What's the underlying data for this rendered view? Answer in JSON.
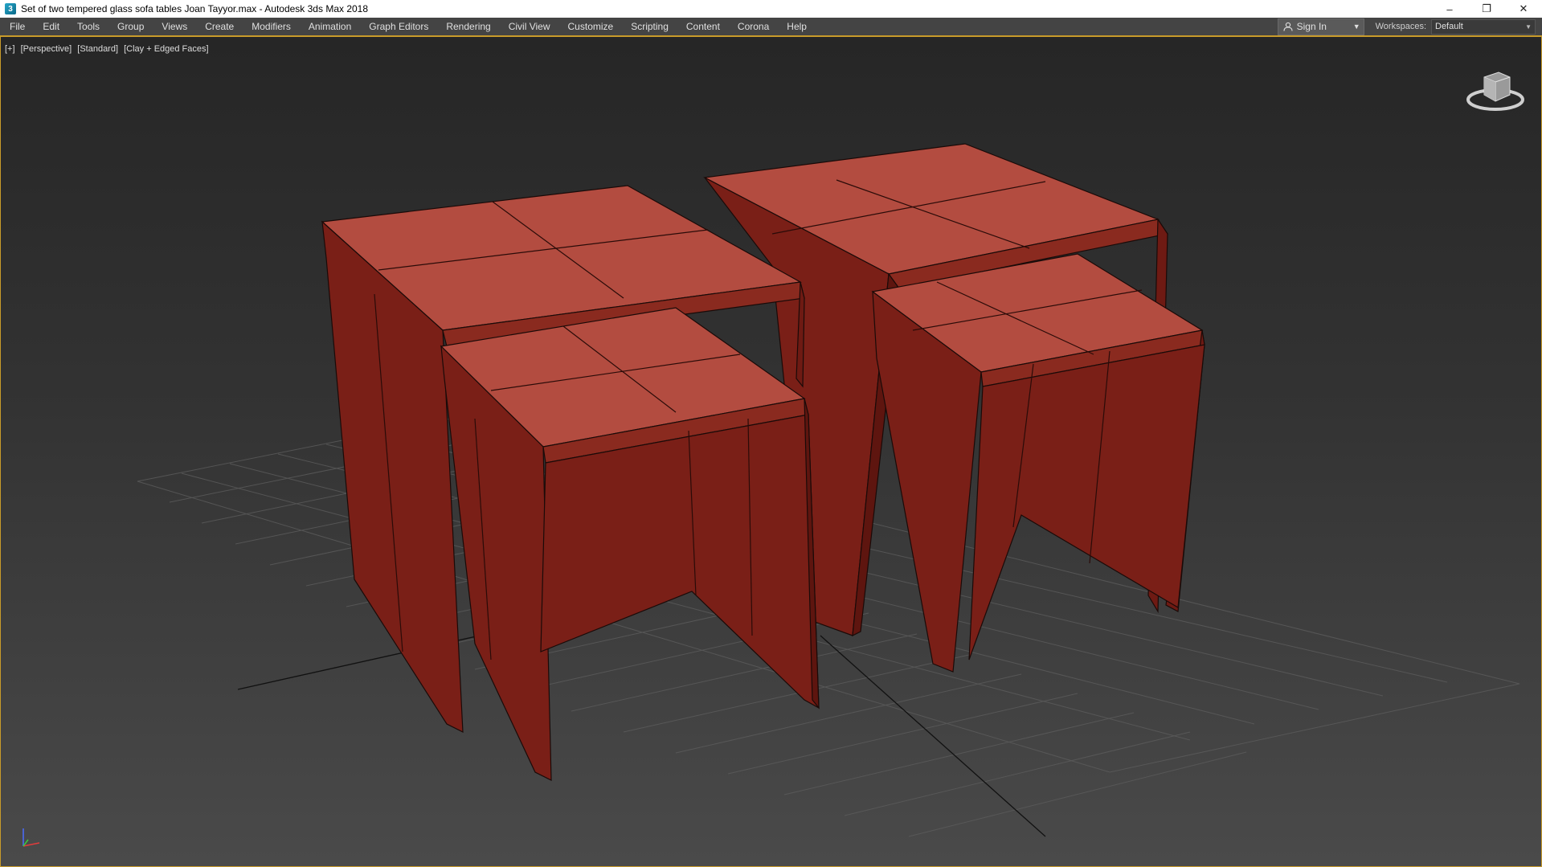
{
  "window": {
    "app_icon": "3ds-max-icon",
    "title": "Set of two tempered glass sofa tables Joan Tayyor.max - Autodesk 3ds Max 2018",
    "controls": {
      "minimize": "–",
      "restore": "❐",
      "close": "✕"
    }
  },
  "menu": {
    "items": [
      "File",
      "Edit",
      "Tools",
      "Group",
      "Views",
      "Create",
      "Modifiers",
      "Animation",
      "Graph Editors",
      "Rendering",
      "Civil View",
      "Customize",
      "Scripting",
      "Content",
      "Corona",
      "Help"
    ],
    "sign_in": "Sign In",
    "workspaces_label": "Workspaces:",
    "workspace_value": "Default"
  },
  "viewport": {
    "labels": [
      "[+]",
      "[Perspective]",
      "[Standard]",
      "[Clay + Edged Faces]"
    ],
    "colors": {
      "accent_border": "#c89b2a",
      "table_top": "#b34c40",
      "table_side": "#7a1f17",
      "table_side_light": "#8a2a1f",
      "edge": "#1a0a08",
      "grid": "#5c5c5c"
    }
  }
}
